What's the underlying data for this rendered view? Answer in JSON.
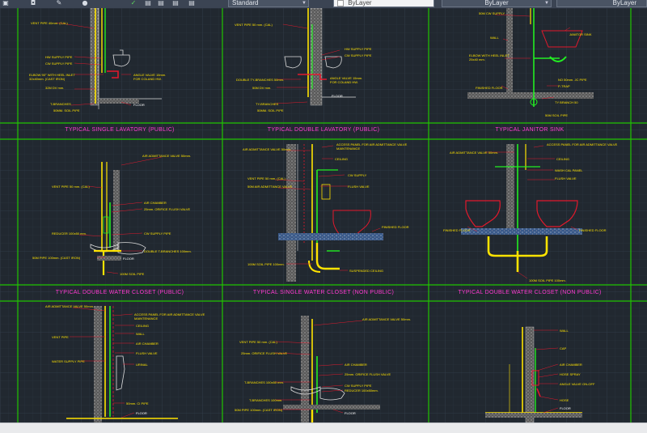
{
  "toolbar": {
    "text_style": "Standard",
    "layer_control": "ByLayer",
    "color_control": "ByLayer",
    "linetype_control": "ByLayer",
    "icons": [
      "cube-icon",
      "bucket-icon",
      "draw-icon",
      "bulb-icon",
      "check-icon",
      "layer-icon",
      "layer-icon",
      "layer-icon",
      "layer-icon"
    ]
  },
  "drawing": {
    "panels": [
      {
        "id": "lav-single",
        "title": "TYPICAL  SINGLE  LAVATORY  (PUBLIC)",
        "notes": [
          "VENT PIPE 40mm. (CAL)",
          "HW SUPPLY PIPE",
          "CW SUPPLY PIPE",
          "ELBOW 90° WITH HEEL INLET",
          "32x40mm. (CAST IRON)",
          "32M DV mm.",
          "T-BRANCHES",
          "50MM. SOIL PIPE",
          "ANGLE VALVE 15mm.",
          "FOR COLAND HW.",
          "FLOOR"
        ]
      },
      {
        "id": "lav-double",
        "title": "TYPICAL  DOUBLE  LAVATORY  (PUBLIC)",
        "notes": [
          "VENT PIPE 50 mm. (CAL)",
          "HW SUPPLY PIPE",
          "CW SUPPLY PIPE",
          "DOUBLE TY-BRANCHES 50mm.",
          "50M DV mm.",
          "TY-BRANCHES",
          "50MM. SOIL PIPE",
          "ANGLE VALVE 15mm.",
          "FOR COLAND HW.",
          "FLOOR"
        ]
      },
      {
        "id": "janitor",
        "title": "TYPICAL  JANITOR  SINK",
        "notes": [
          "50M CW SUPPLY",
          "WALL",
          "ELBOW WITH HEEL INLET",
          "25x40 mm.",
          "FINISHED FLOOR",
          "JANITOR SINK",
          "NO 50mm. JC PIPE",
          "P-TRAP",
          "TY BRANCH 50",
          "50M SOIL PIPE"
        ]
      },
      {
        "id": "wc-double-public",
        "title": "TYPICAL  DOUBLE  WATER  CLOSET  (PUBLIC)",
        "notes": [
          "AIR ADMITTANCE VALVE 50mm.",
          "VENT PIPE 50 mm. (CAL)",
          "AIR CHAMBER",
          "25mm. ORIFICE FLUSH VALVE",
          "CW SUPPLY PIPE",
          "REDUCER 100x50 mm.",
          "DOUBLE T-BRANCHES 100mm.",
          "50M PIPE 100mm. (CAST IRON)",
          "FLOOR",
          "100M SOIL PIPE"
        ]
      },
      {
        "id": "wc-single-nonpublic",
        "title": "TYPICAL  SINGLE  WATER  CLOSET  (NON  PUBLIC)",
        "notes": [
          "AIR ADMITTANCE VALVE 50mm.",
          "ACCESS PANEL FOR AIR ADMITTANCE VALVE",
          "MAINTENANCE",
          "CEILING",
          "VENT PIPE 50 mm. (CAL)",
          "50M AIR ADMITTANCE VALVE",
          "CW SUPPLY",
          "FLUSH VALVE",
          "FINISHED FLOOR",
          "100M SOIL PIPE 100mm.",
          "SUSPENDED CEILING"
        ]
      },
      {
        "id": "wc-double-nonpublic",
        "title": "TYPICAL  DOUBLE  WATER  CLOSET  (NON  PUBLIC)",
        "notes": [
          "AIR ADMITTANCE VALVE 50mm.",
          "ACCESS PANEL FOR AIR ADMITTANCE VALVE",
          "CEILING",
          "WASH CAL PANEL",
          "FLUSH VALVE",
          "FINISHED FLOOR",
          "FINISHED FLOOR",
          "100M SOIL PIPE 100mm."
        ]
      },
      {
        "id": "urinal",
        "title": "",
        "notes": [
          "AIR ADMITTANCE VALVE 50mm.",
          "ACCESS PANEL FOR AIR ADMITTANCE VALVE",
          "MAINTENANCE",
          "CEILING",
          "WALL",
          "VENT PIPE",
          "AIR CHAMBER",
          "FLUSH VALVE",
          "WATER SUPPLY PIPE",
          "URINAL",
          "50mm. CI PIPE",
          "FLOOR"
        ]
      },
      {
        "id": "wc-bottom-mid",
        "title": "",
        "notes": [
          "AIR ADMITTANCE VALVE 50mm.",
          "VENT PIPE 50 mm. (CAL)",
          "25mm. ORIFICE FLUSH VALVE",
          "AIR CHAMBER",
          "25mm. ORIFICE FLUSH VALVE",
          "CW SUPPLY PIPE",
          "REDUCER 100x50mm.",
          "T-BRANCHES 100x50 mm.",
          "T-BRANCHES 100mm.",
          "50M PIPE 100mm. (CAST IRON)",
          "FLOOR"
        ]
      },
      {
        "id": "hose-bib",
        "title": "",
        "notes": [
          "WALL",
          "CAP",
          "AIR CHAMBER",
          "HOSE SPRAY",
          "ANGLE VALVE ON-OFF",
          "HOSE",
          "FLOOR"
        ]
      }
    ]
  },
  "colors": {
    "background": "#212830",
    "grid": "#2c3440",
    "frame": "#21c400",
    "title": "#ff3ad1",
    "pipe_yellow": "#ffe300",
    "pipe_green": "#22ee22",
    "fixture_red": "#e2192c",
    "wall_gray": "#8c8c8c"
  }
}
